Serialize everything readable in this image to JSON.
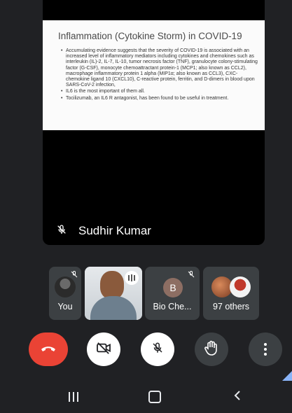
{
  "slide": {
    "title": "Inflammation (Cytokine Storm) in COVID-19",
    "bullets": [
      "Accumulating evidence suggests that the severity of COVID-19 is associated with an increased level of inflammatory mediators including cytokines and chemokines such as interleukin (IL)-2, IL-7, IL-10, tumor necrosis factor (TNF), granulocyte colony-stimulating factor (G-CSF), monocyte chemoattractant protein-1 (MCP1; also known as CCL2), macrophage inflammatory protein 1 alpha (MIP1α; also known as CCL3), CXC-chemokine ligand 10 (CXCL10), C-reactive protein, ferritin, and D-dimers in blood upon SARS-CoV-2 infection,",
      "IL6 is the most important of them all.",
      "Tocilizumab, an IL6 R antagonist, has been found to be useful in treatment."
    ]
  },
  "presenter": {
    "name": "Sudhir Kumar",
    "mic_icon": "mic-off-icon"
  },
  "participants": [
    {
      "label": "You",
      "muted": true
    },
    {
      "label": "",
      "speaking": true
    },
    {
      "label": "Bio Che...",
      "initial": "B",
      "muted": true,
      "avatar_color": "#8d6e63"
    },
    {
      "label": "97 others"
    }
  ],
  "controls": {
    "end_call_color": "#ea4335",
    "icons": [
      "end-call-icon",
      "camera-off-icon",
      "mic-off-icon",
      "raise-hand-icon",
      "more-options-icon"
    ]
  },
  "nav": {
    "icons": [
      "recent-apps-icon",
      "home-icon",
      "back-icon"
    ]
  }
}
